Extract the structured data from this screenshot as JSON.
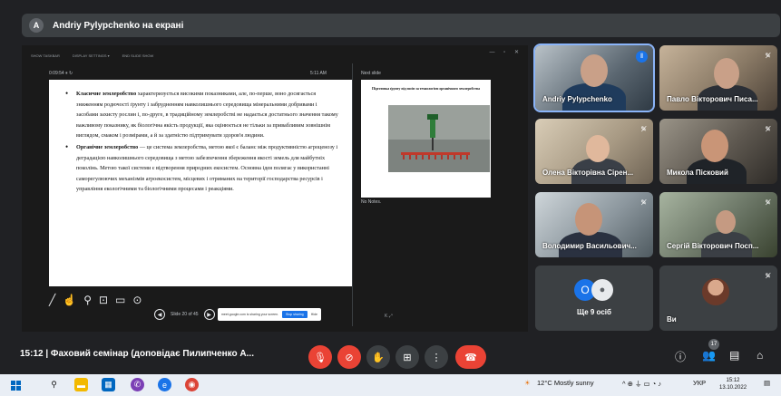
{
  "banner": {
    "avatar_letter": "A",
    "title": "Andriy Pylypchenko на екрані"
  },
  "presentation": {
    "toolbar_items": [
      "SHOW TASKBAR",
      "DISPLAY SETTINGS ▾",
      "END SLIDE SHOW"
    ],
    "window_controls": "— ▫ ✕",
    "timer": "0:09:54  ⏸  ↻",
    "clock": "5:11 AM",
    "next_slide_label": "Next slide",
    "slide": {
      "item1_bold": "Класичне землеробство",
      "item1_text": " характеризується високими показниками, але, по-перше, воно досягається зниженням родючості ґрунту і забрудненням навколишнього середовища мінеральними добривами і засобами захисту рослин і, по-друге, в традиційному землеробстві не надається достатнього значення такому важливому показнику, як біологічна якість продукції, яка оцінюється не тільки за привабливим зовнішнім виглядом, смаком і розмірами, а й за здатністю підтримувати здоров'я людини.",
      "item2_bold": "Органічне землеробство",
      "item2_text": " — це система землеробства, метою якої є баланс між продуктивністю агроценозу і деградацією навколишнього середовища з метою забезпечення збереження якості земель для майбутніх поколінь. Метою такої системи є відтворення природних екосистем. Основна ідея полягає у використанні саморегулюючих механізмів агроекосистем, місцевих і отриманих на території господарства ресурсів і управління екологічними та біологічними процесами і реакціями."
    },
    "next_slide_title": "Підготовка ґрунту під посів за технологією органічного землеробства",
    "notes": "No Notes.",
    "slide_counter": "Slide 20 of 45",
    "toast_text": "meet.google.com is sharing your screen.",
    "toast_stop": "Stop sharing",
    "toast_hide": "Hide",
    "corner_text": "K  ⤢",
    "tool_icons": [
      "pen-icon",
      "pointer-icon",
      "zoom-icon",
      "subtitles-icon",
      "screen-icon",
      "more-icon"
    ]
  },
  "participants": [
    {
      "name": "Andriy Pylypchenko",
      "active": true
    },
    {
      "name": "Павло Вікторович Писа..."
    },
    {
      "name": "Олена Вікторівна Сірен..."
    },
    {
      "name": "Микола Пісковий"
    },
    {
      "name": "Володимир Васильович..."
    },
    {
      "name": "Сергій Вікторович Посп..."
    }
  ],
  "others": {
    "count_label": "Ще 9 осіб",
    "bubble": "О"
  },
  "you": {
    "label": "Ви"
  },
  "bottom": {
    "meeting": "15:12  |  Фаховий семінар (доповідає Пилипченко А...",
    "people_count": "17"
  },
  "taskbar": {
    "weather": "12°C  Mostly sunny",
    "lang": "УКР",
    "time": "15:12",
    "date": "13.10.2022"
  }
}
